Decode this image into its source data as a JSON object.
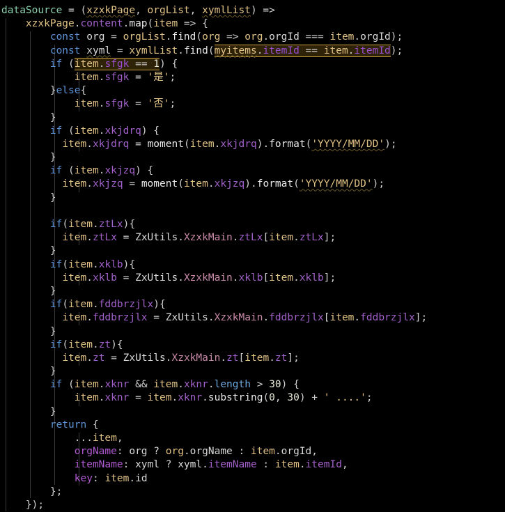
{
  "editor": {
    "language": "javascript",
    "background": "#000000",
    "font_size_px": 14.5,
    "line_height_px": 19.2,
    "indent_guides": true
  },
  "colors": {
    "background": "#000000",
    "foreground": "#d8d8d8",
    "keyword": "#5c93d6",
    "variable": "#e0c184",
    "declaration": "#8bcfae",
    "property": "#a060c8",
    "object_key": "#b05ad0",
    "class": "#c98aa8",
    "string": "#e0c184",
    "builtin_property": "#6fa8dc",
    "highlight_background": "#3a2a10",
    "highlight_border": "#c8a23c",
    "indent_guide": "#3a3a3a",
    "spellcheck_squiggle": "#6b5a2a"
  },
  "highlights": {
    "occurrences": [
      "itemId",
      "sfgk"
    ],
    "note": "matching-occurrence highlight with yellow outline"
  },
  "code": {
    "lines": [
      "dataSource = (xzxkPage, orgList, xymlList) =>",
      "    xzxkPage.content.map(item => {",
      "        const org = orgList.find(org => org.orgId === item.orgId);",
      "        const xyml = xymlList.find(myitems => myitems.itemId == item.itemId);",
      "        if (item.sfgk == 1) {",
      "            item.sfgk = '是';",
      "        }else{",
      "            item.sfgk = '否';",
      "        }",
      "        if (item.xkjdrq) {",
      "          item.xkjdrq = moment(item.xkjdrq).format('YYYY/MM/DD');",
      "        }",
      "        if (item.xkjzq) {",
      "          item.xkjzq = moment(item.xkjzq).format('YYYY/MM/DD');",
      "        }",
      "",
      "        if(item.ztLx){",
      "          item.ztLx = ZxUtils.XzxkMain.ztLx[item.ztLx];",
      "        }",
      "        if(item.xklb){",
      "          item.xklb = ZxUtils.XzxkMain.xklb[item.xklb];",
      "        }",
      "        if(item.fddbrzjlx){",
      "          item.fddbrzjlx = ZxUtils.XzxkMain.fddbrzjlx[item.fddbrzjlx];",
      "        }",
      "        if(item.zt){",
      "          item.zt = ZxUtils.XzxkMain.zt[item.zt];",
      "        }",
      "        if (item.xknr && item.xknr.length > 30) {",
      "            item.xknr = item.xknr.substring(0, 30) + ' ....';",
      "        }",
      "        return {",
      "            ...item,",
      "            orgName: org ? org.orgName : item.orgId,",
      "            itemName: xyml ? xyml.itemName : item.itemId,",
      "            key: item.id",
      "        };",
      "    });"
    ],
    "tokens": {
      "l1": {
        "decl": "dataSource",
        "p1": "xzxkPage",
        "p2": "orgList",
        "p3": "xymlList",
        "arrow": "=>"
      },
      "l2": {
        "obj": "xzxkPage",
        "prop": "content",
        "fn": "map",
        "param": "item"
      },
      "l3": {
        "kw": "const",
        "name": "org",
        "src": "orgList",
        "fn": "find",
        "param": "org",
        "propA": "orgId",
        "op": "===",
        "propB": "orgId"
      },
      "l4": {
        "kw": "const",
        "name": "xyml",
        "src": "xymlList",
        "fn": "find",
        "param": "myitems",
        "propA": "itemId",
        "op": "==",
        "propB": "itemId"
      },
      "l5": {
        "kw": "if",
        "prop": "sfgk",
        "op": "==",
        "num": "1"
      },
      "l6": {
        "prop": "sfgk",
        "str": "是"
      },
      "l7": {
        "kw": "else"
      },
      "l8": {
        "prop": "sfgk",
        "str": "否"
      },
      "l10": {
        "kw": "if",
        "prop": "xkjdrq"
      },
      "l11": {
        "prop": "xkjdrq",
        "fn": "moment",
        "method": "format",
        "str": "YYYY/MM/DD"
      },
      "l13": {
        "kw": "if",
        "prop": "xkjzq"
      },
      "l14": {
        "prop": "xkjzq",
        "fn": "moment",
        "method": "format",
        "str": "YYYY/MM/DD"
      },
      "l17": {
        "kw": "if",
        "prop": "ztLx"
      },
      "l18": {
        "prop": "ztLx",
        "ns": "ZxUtils",
        "cls": "XzxkMain"
      },
      "l20": {
        "kw": "if",
        "prop": "xklb"
      },
      "l21": {
        "prop": "xklb",
        "ns": "ZxUtils",
        "cls": "XzxkMain"
      },
      "l23": {
        "kw": "if",
        "prop": "fddbrzjlx"
      },
      "l24": {
        "prop": "fddbrzjlx",
        "ns": "ZxUtils",
        "cls": "XzxkMain"
      },
      "l26": {
        "kw": "if",
        "prop": "zt"
      },
      "l27": {
        "prop": "zt",
        "ns": "ZxUtils",
        "cls": "XzxkMain"
      },
      "l29": {
        "kw": "if",
        "prop": "xknr",
        "builtin": "length",
        "op": ">",
        "num": "30"
      },
      "l30": {
        "prop": "xknr",
        "method": "substring",
        "args": "0, 30",
        "str": " ...."
      },
      "l32": {
        "kw": "return"
      },
      "l33": {
        "spread": "...item"
      },
      "l34": {
        "key": "orgName",
        "var": "org",
        "prop": "orgName",
        "fallback": "orgId"
      },
      "l35": {
        "key": "itemName",
        "var": "xyml",
        "prop": "itemName",
        "fallback": "itemId"
      },
      "l36": {
        "key": "key",
        "value": "item.id"
      }
    }
  }
}
